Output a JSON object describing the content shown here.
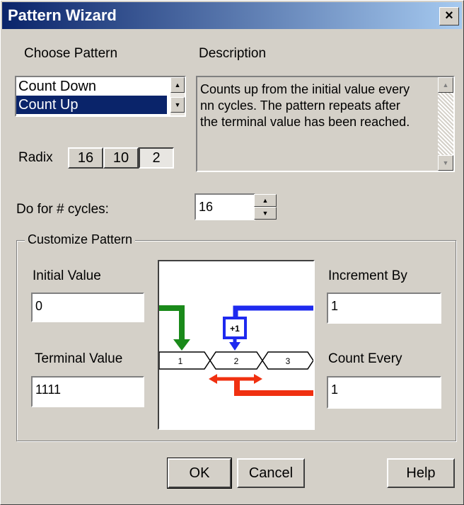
{
  "window": {
    "title": "Pattern Wizard",
    "close_glyph": "×"
  },
  "choose_pattern": {
    "label": "Choose Pattern",
    "items": [
      {
        "label": "Count Down",
        "selected": false
      },
      {
        "label": "Count Up",
        "selected": true
      }
    ]
  },
  "description": {
    "label": "Description",
    "text": "Counts up from the initial value every nn cycles.  The pattern repeats after the terminal value has been reached."
  },
  "radix": {
    "label": "Radix",
    "options": [
      "16",
      "10",
      "2"
    ],
    "selected": "2"
  },
  "cycles": {
    "label": "Do for # cycles:",
    "value": "16"
  },
  "customize": {
    "title": "Customize Pattern",
    "initial_label": "Initial Value",
    "initial_value": "0",
    "terminal_label": "Terminal Value",
    "terminal_value": "1111",
    "increment_label": "Increment By",
    "increment_value": "1",
    "count_every_label": "Count Every",
    "count_every_value": "1"
  },
  "diagram": {
    "increment_box": "+1",
    "cells": [
      "1",
      "2",
      "3"
    ]
  },
  "buttons": {
    "ok": "OK",
    "cancel": "Cancel",
    "help": "Help"
  },
  "colors": {
    "title_bar": "#0a246a",
    "selection": "#0a246a",
    "green_arrow": "#1a8a1a",
    "blue_arrow": "#1e2aef",
    "red_arrow": "#f03010"
  }
}
